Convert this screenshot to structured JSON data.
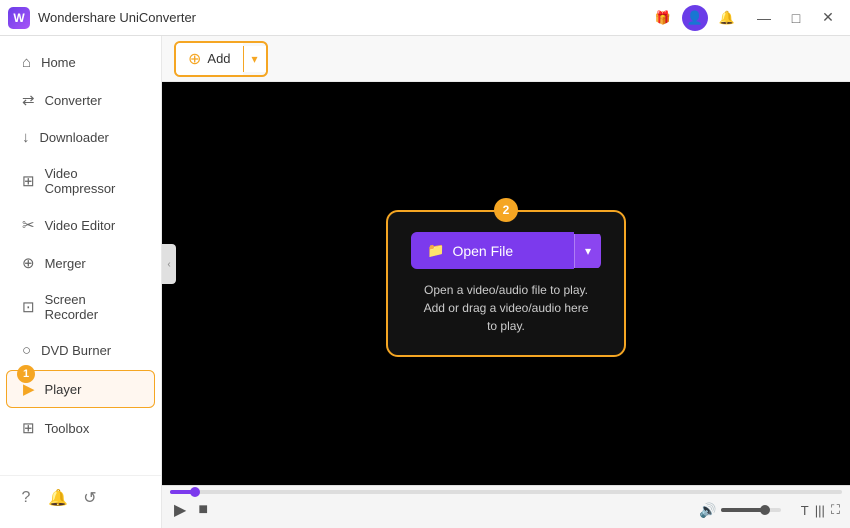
{
  "app": {
    "title": "Wondershare UniConverter",
    "logo_text": "W"
  },
  "titlebar": {
    "gift_icon": "🎁",
    "user_icon": "👤",
    "bell_icon": "🔔",
    "minimize": "—",
    "maximize": "□",
    "close": "✕"
  },
  "sidebar": {
    "items": [
      {
        "id": "home",
        "label": "Home",
        "icon": "⌂"
      },
      {
        "id": "converter",
        "label": "Converter",
        "icon": "⇄"
      },
      {
        "id": "downloader",
        "label": "Downloader",
        "icon": "↓"
      },
      {
        "id": "video-compressor",
        "label": "Video Compressor",
        "icon": "⊞"
      },
      {
        "id": "video-editor",
        "label": "Video Editor",
        "icon": "✂"
      },
      {
        "id": "merger",
        "label": "Merger",
        "icon": "⊕"
      },
      {
        "id": "screen-recorder",
        "label": "Screen Recorder",
        "icon": "⊡"
      },
      {
        "id": "dvd-burner",
        "label": "DVD Burner",
        "icon": "○"
      },
      {
        "id": "player",
        "label": "Player",
        "icon": "▶",
        "active": true,
        "badge": "1"
      },
      {
        "id": "toolbox",
        "label": "Toolbox",
        "icon": "⊞"
      }
    ],
    "bottom_icons": [
      "?",
      "🔔",
      "↺"
    ]
  },
  "toolbar": {
    "add_button_icon": "⊞",
    "add_button_label": "Add",
    "add_button_arrow": "▾"
  },
  "player": {
    "open_file_badge": "2",
    "open_file_button": "Open File",
    "open_file_arrow": "▾",
    "open_file_icon": "📁",
    "hint_line1": "Open a video/audio file to play.",
    "hint_line2": "Add or drag a video/audio here to play."
  },
  "playback": {
    "play_icon": "▶",
    "stop_icon": "■",
    "volume_icon": "🔊",
    "subtitle_icon": "T",
    "speed_icon": "|||",
    "screen_icon": "⛶"
  },
  "colors": {
    "accent_orange": "#f5a623",
    "accent_purple": "#7c3aed",
    "active_bg": "#fff7f0",
    "sidebar_bg": "#ffffff"
  }
}
